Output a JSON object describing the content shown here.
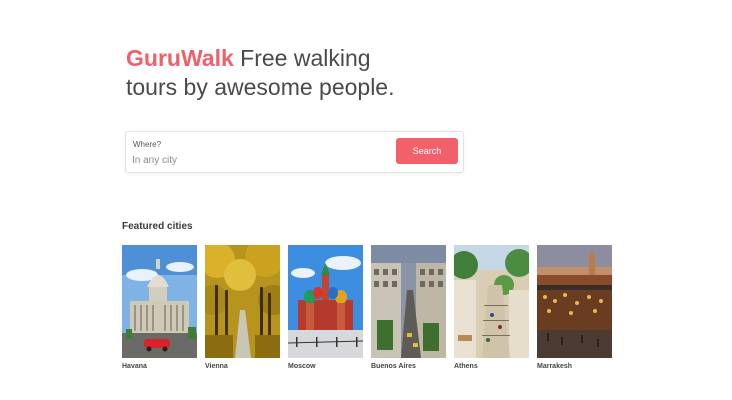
{
  "hero": {
    "brand": "GuruWalk",
    "tagline_part1": "Free walking",
    "tagline_part2": "tours by awesome people."
  },
  "search": {
    "label": "Where?",
    "placeholder": "In any city",
    "button_label": "Search"
  },
  "featured": {
    "title": "Featured cities",
    "cities": [
      {
        "name": "Havana"
      },
      {
        "name": "Vienna"
      },
      {
        "name": "Moscow"
      },
      {
        "name": "Buenos Aires"
      },
      {
        "name": "Athens"
      },
      {
        "name": "Marrakesh"
      }
    ]
  },
  "colors": {
    "brand": "#f0606a",
    "button": "#f2606b"
  }
}
